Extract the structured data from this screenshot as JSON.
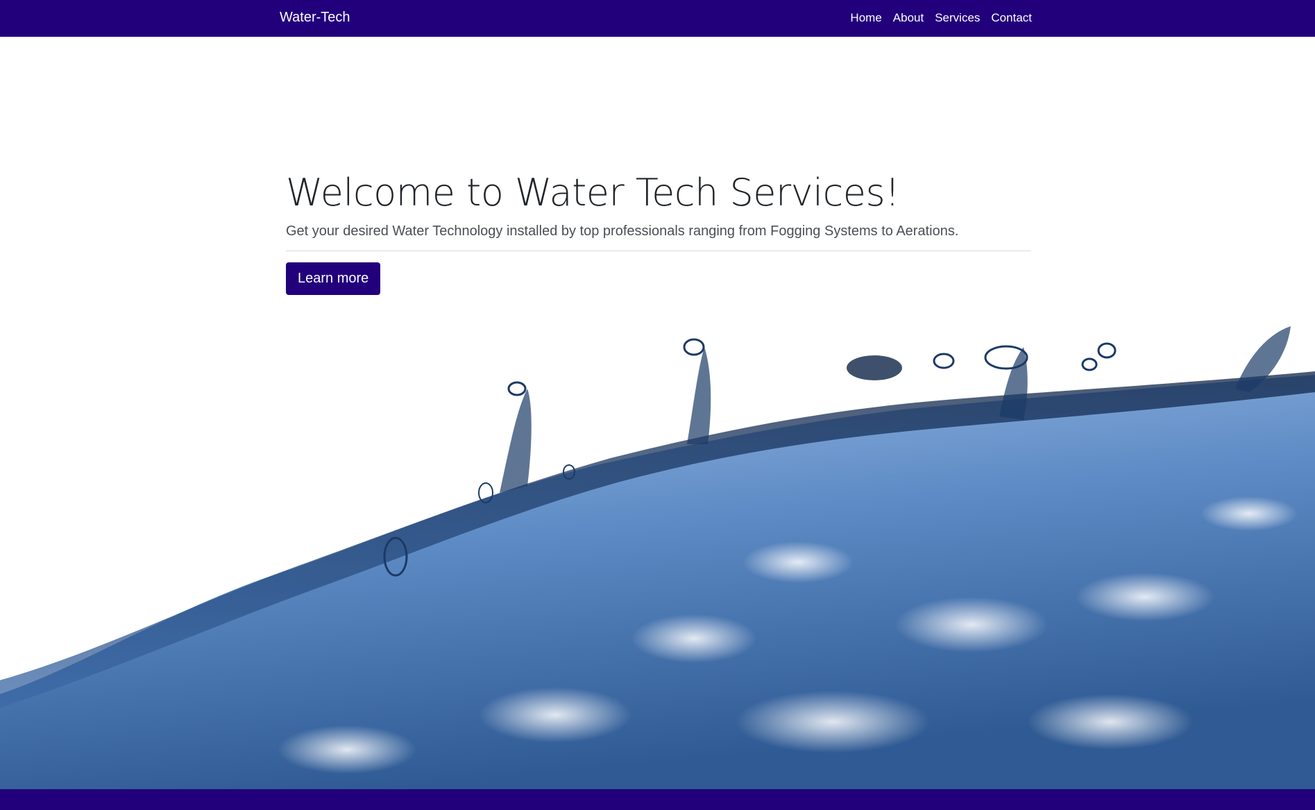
{
  "navbar": {
    "brand": "Water-Tech",
    "links": [
      {
        "label": "Home"
      },
      {
        "label": "About"
      },
      {
        "label": "Services"
      },
      {
        "label": "Contact"
      }
    ]
  },
  "hero": {
    "title": "Welcome to Water Tech Services!",
    "subtitle": "Get your desired Water Technology installed by top professionals ranging from Fogging Systems to Aerations.",
    "button_label": "Learn more"
  },
  "colors": {
    "brand": "#22007c",
    "water_light": "#c9dcf2",
    "water_mid": "#7da3d6",
    "water_dark": "#1b3a66"
  },
  "images": {
    "hero_background": "water-splash-image"
  }
}
